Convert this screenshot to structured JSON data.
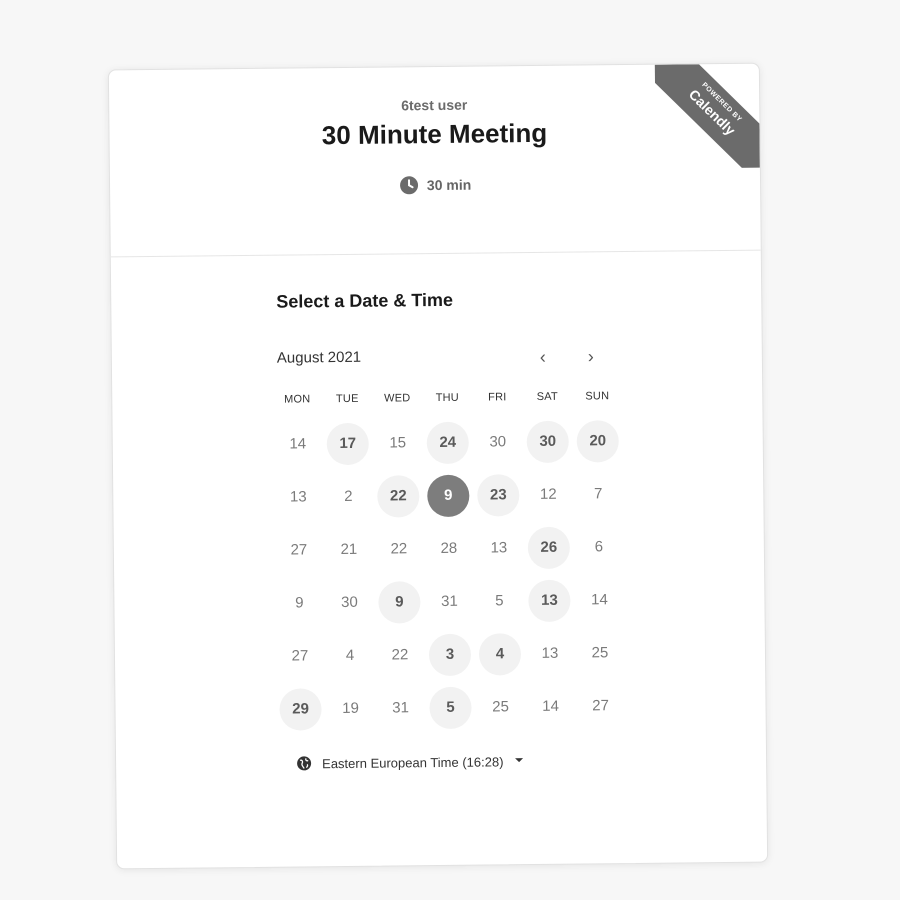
{
  "header": {
    "owner_name": "6test user",
    "event_title": "30 Minute Meeting",
    "duration": "30 min",
    "ribbon_small": "POWERED BY",
    "ribbon_brand": "Calendly"
  },
  "icons": {
    "duration": "clock-icon",
    "timezone": "globe-icon",
    "prev": "chevron-left-icon",
    "next": "chevron-right-icon",
    "timezone_dropdown": "caret-down-icon"
  },
  "scheduler": {
    "section_title": "Select a Date & Time",
    "month_label": "August 2021",
    "prev_glyph": "‹",
    "next_glyph": "›",
    "weekdays": [
      "MON",
      "TUE",
      "WED",
      "THU",
      "FRI",
      "SAT",
      "SUN"
    ],
    "days": [
      {
        "label": "14",
        "state": "unavailable"
      },
      {
        "label": "17",
        "state": "available"
      },
      {
        "label": "15",
        "state": "unavailable"
      },
      {
        "label": "24",
        "state": "available"
      },
      {
        "label": "30",
        "state": "unavailable"
      },
      {
        "label": "30",
        "state": "available"
      },
      {
        "label": "20",
        "state": "available"
      },
      {
        "label": "13",
        "state": "unavailable"
      },
      {
        "label": "2",
        "state": "unavailable"
      },
      {
        "label": "22",
        "state": "available"
      },
      {
        "label": "9",
        "state": "selected"
      },
      {
        "label": "23",
        "state": "available"
      },
      {
        "label": "12",
        "state": "unavailable"
      },
      {
        "label": "7",
        "state": "unavailable"
      },
      {
        "label": "27",
        "state": "unavailable"
      },
      {
        "label": "21",
        "state": "unavailable"
      },
      {
        "label": "22",
        "state": "unavailable"
      },
      {
        "label": "28",
        "state": "unavailable"
      },
      {
        "label": "13",
        "state": "unavailable"
      },
      {
        "label": "26",
        "state": "available"
      },
      {
        "label": "6",
        "state": "unavailable"
      },
      {
        "label": "9",
        "state": "unavailable"
      },
      {
        "label": "30",
        "state": "unavailable"
      },
      {
        "label": "9",
        "state": "available"
      },
      {
        "label": "31",
        "state": "unavailable"
      },
      {
        "label": "5",
        "state": "unavailable"
      },
      {
        "label": "13",
        "state": "available"
      },
      {
        "label": "14",
        "state": "unavailable"
      },
      {
        "label": "27",
        "state": "unavailable"
      },
      {
        "label": "4",
        "state": "unavailable"
      },
      {
        "label": "22",
        "state": "unavailable"
      },
      {
        "label": "3",
        "state": "available"
      },
      {
        "label": "4",
        "state": "available"
      },
      {
        "label": "13",
        "state": "unavailable"
      },
      {
        "label": "25",
        "state": "unavailable"
      },
      {
        "label": "29",
        "state": "available"
      },
      {
        "label": "19",
        "state": "unavailable"
      },
      {
        "label": "31",
        "state": "unavailable"
      },
      {
        "label": "5",
        "state": "available"
      },
      {
        "label": "25",
        "state": "unavailable"
      },
      {
        "label": "14",
        "state": "unavailable"
      },
      {
        "label": "27",
        "state": "unavailable"
      }
    ],
    "timezone_label": "Eastern European Time (16:28)"
  }
}
